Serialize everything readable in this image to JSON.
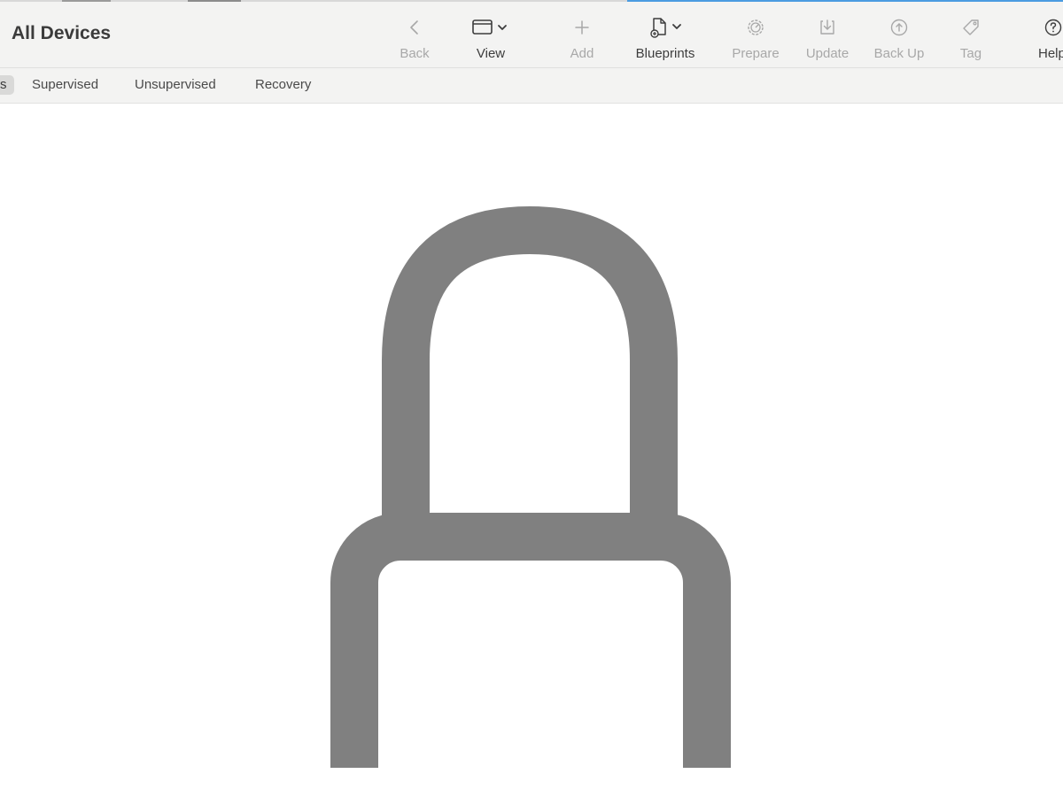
{
  "window": {
    "title": "All Devices"
  },
  "toolbar": {
    "back": {
      "label": "Back",
      "icon": "chevron-left-icon",
      "enabled": false
    },
    "view": {
      "label": "View",
      "icon": "window-view-icon",
      "enabled": true
    },
    "add": {
      "label": "Add",
      "icon": "plus-icon",
      "enabled": false
    },
    "blueprints": {
      "label": "Blueprints",
      "icon": "blueprint-doc-icon",
      "enabled": true
    },
    "prepare": {
      "label": "Prepare",
      "icon": "gear-icon",
      "enabled": false
    },
    "update": {
      "label": "Update",
      "icon": "download-tray-icon",
      "enabled": false
    },
    "backup": {
      "label": "Back Up",
      "icon": "arrow-up-circle-icon",
      "enabled": false
    },
    "tag": {
      "label": "Tag",
      "icon": "tag-icon",
      "enabled": false
    },
    "help": {
      "label": "Help",
      "icon": "question-circle-icon",
      "enabled": true
    }
  },
  "filters": {
    "items": [
      {
        "label": "s",
        "selected": true
      },
      {
        "label": "Supervised",
        "selected": false
      },
      {
        "label": "Unsupervised",
        "selected": false
      },
      {
        "label": "Recovery",
        "selected": false
      }
    ]
  },
  "content": {
    "icon": "padlock-icon",
    "icon_color": "#808080"
  },
  "colors": {
    "toolbar_bg": "#f3f3f2",
    "enabled_text": "#3d3d3d",
    "disabled_text": "#a8a8a8",
    "accent_blue": "#4a9be0"
  }
}
